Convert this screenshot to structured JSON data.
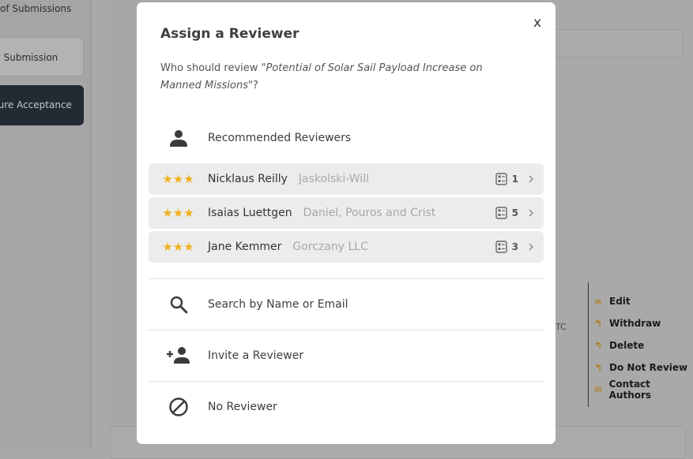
{
  "background": {
    "breadcrumb": "of Submissions",
    "sidebar_light_button": "w Submission",
    "sidebar_dark_button": "gure Acceptance",
    "partial_text": "TC",
    "actions": [
      {
        "label": "Edit",
        "icon": "link-icon"
      },
      {
        "label": "Withdraw",
        "icon": "withdraw-icon"
      },
      {
        "label": "Delete",
        "icon": "delete-icon"
      },
      {
        "label": "Do Not Review",
        "icon": "do-not-review-icon"
      },
      {
        "label": "Contact Authors",
        "icon": "mail-icon"
      }
    ]
  },
  "modal": {
    "close_label": "x",
    "title": "Assign a Reviewer",
    "question_prefix": "Who should review ",
    "question_title": "\"Potential of Solar Sail Payload Increase on Manned Missions\"",
    "question_suffix": "?",
    "recommended_label": "Recommended Reviewers",
    "reviewers": [
      {
        "stars": "★★★",
        "name": "Nicklaus Reilly",
        "org": "Jaskolski-Will",
        "count": "1"
      },
      {
        "stars": "★★★",
        "name": "Isaias Luettgen",
        "org": "Daniel, Pouros and Crist",
        "count": "5"
      },
      {
        "stars": "★★★",
        "name": "Jane Kemmer",
        "org": "Gorczany LLC",
        "count": "3"
      }
    ],
    "options": {
      "search": "Search by Name or Email",
      "invite": "Invite a Reviewer",
      "none": "No Reviewer"
    }
  },
  "colors": {
    "star": "#f2b01e",
    "overlay": "#a9a9a9",
    "dark_button": "#222a33"
  }
}
